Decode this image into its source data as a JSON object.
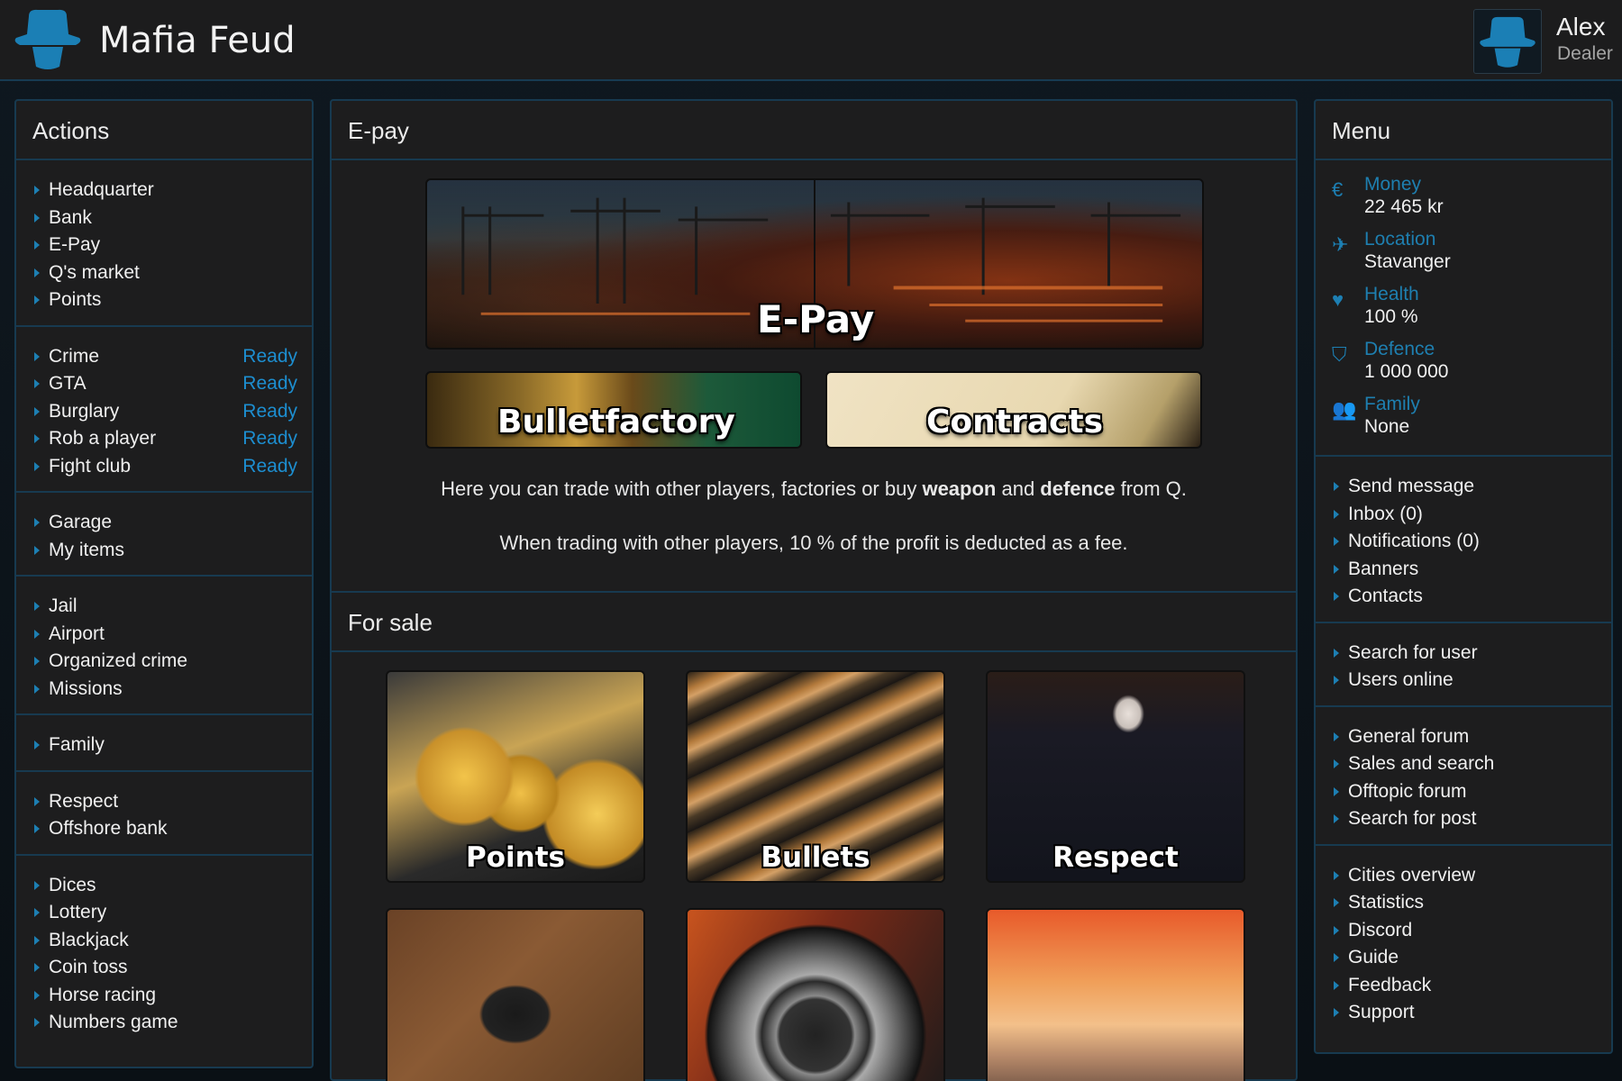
{
  "header": {
    "app_title": "Mafia Feud",
    "user_name": "Alex",
    "user_rank": "Dealer"
  },
  "actions": {
    "title": "Actions",
    "groups": [
      [
        {
          "label": "Headquarter"
        },
        {
          "label": "Bank"
        },
        {
          "label": "E-Pay"
        },
        {
          "label": "Q's market"
        },
        {
          "label": "Points"
        }
      ],
      [
        {
          "label": "Crime",
          "status": "Ready"
        },
        {
          "label": "GTA",
          "status": "Ready"
        },
        {
          "label": "Burglary",
          "status": "Ready"
        },
        {
          "label": "Rob a player",
          "status": "Ready"
        },
        {
          "label": "Fight club",
          "status": "Ready"
        }
      ],
      [
        {
          "label": "Garage"
        },
        {
          "label": "My items"
        }
      ],
      [
        {
          "label": "Jail"
        },
        {
          "label": "Airport"
        },
        {
          "label": "Organized crime"
        },
        {
          "label": "Missions"
        }
      ],
      [
        {
          "label": "Family"
        }
      ],
      [
        {
          "label": "Respect"
        },
        {
          "label": "Offshore bank"
        }
      ],
      [
        {
          "label": "Dices"
        },
        {
          "label": "Lottery"
        },
        {
          "label": "Blackjack"
        },
        {
          "label": "Coin toss"
        },
        {
          "label": "Horse racing"
        },
        {
          "label": "Numbers game"
        }
      ]
    ]
  },
  "epay": {
    "title": "E-pay",
    "banner_main": "E-Pay",
    "banner_left": "Bulletfactory",
    "banner_right": "Contracts",
    "desc_1_pre": "Here you can trade with other players, factories or buy ",
    "desc_1_b1": "weapon",
    "desc_1_mid": " and ",
    "desc_1_b2": "defence",
    "desc_1_post": " from Q.",
    "desc_2": "When trading with other players, 10 % of the profit is deducted as a fee."
  },
  "for_sale": {
    "title": "For sale",
    "tiles": [
      "Points",
      "Bullets",
      "Respect"
    ]
  },
  "menu": {
    "title": "Menu",
    "stats": [
      {
        "label": "Money",
        "value": "22 465 kr",
        "icon": "euro-icon"
      },
      {
        "label": "Location",
        "value": "Stavanger",
        "icon": "plane-icon"
      },
      {
        "label": "Health",
        "value": "100 %",
        "icon": "heart-icon"
      },
      {
        "label": "Defence",
        "value": "1 000 000",
        "icon": "shield-icon"
      },
      {
        "label": "Family",
        "value": "None",
        "icon": "users-icon"
      }
    ],
    "groups": [
      [
        {
          "label": "Send message"
        },
        {
          "label": "Inbox (0)"
        },
        {
          "label": "Notifications (0)"
        },
        {
          "label": "Banners"
        },
        {
          "label": "Contacts"
        }
      ],
      [
        {
          "label": "Search for user"
        },
        {
          "label": "Users online"
        }
      ],
      [
        {
          "label": "General forum"
        },
        {
          "label": "Sales and search"
        },
        {
          "label": "Offtopic forum"
        },
        {
          "label": "Search for post"
        }
      ],
      [
        {
          "label": "Cities overview"
        },
        {
          "label": "Statistics"
        },
        {
          "label": "Discord"
        },
        {
          "label": "Guide"
        },
        {
          "label": "Feedback"
        },
        {
          "label": "Support"
        }
      ]
    ]
  },
  "colors": {
    "accent": "#1d7fb3",
    "ready": "#1d8ed0",
    "panel_bg": "#1d1d1e",
    "border": "#173a50"
  }
}
